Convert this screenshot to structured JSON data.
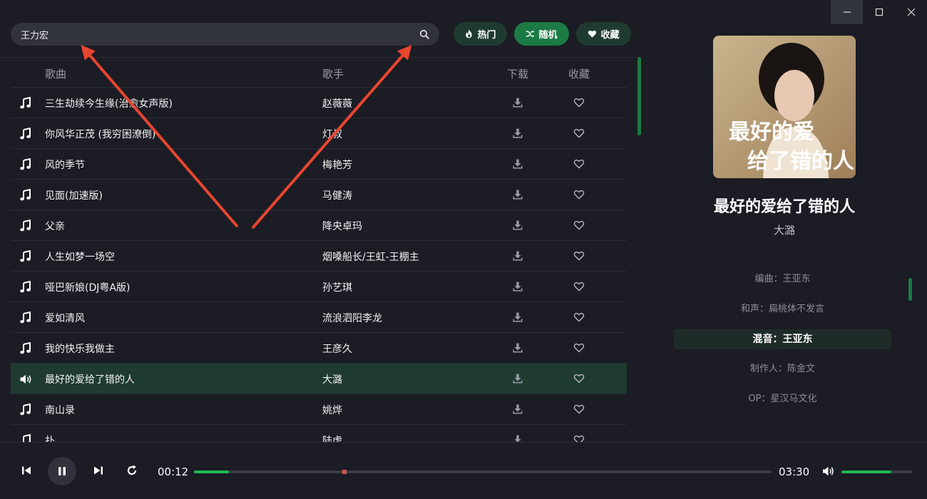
{
  "window": {
    "controls": [
      "minimize-icon",
      "maximize-icon",
      "close-icon"
    ]
  },
  "search": {
    "value": "王力宏",
    "icon": "search-icon"
  },
  "filters": {
    "hot": {
      "label": "热门",
      "icon": "fire-icon"
    },
    "random": {
      "label": "随机",
      "icon": "shuffle-icon"
    },
    "favorites": {
      "label": "收藏",
      "icon": "heart-icon"
    }
  },
  "table": {
    "headers": {
      "song": "歌曲",
      "artist": "歌手",
      "download": "下载",
      "favorite": "收藏"
    },
    "rows": [
      {
        "title": "三生劫续今生缘(治愈女声版)",
        "artist": "赵薇薇",
        "active": false
      },
      {
        "title": "你风华正茂 (我穷困潦倒)",
        "artist": "灯叔",
        "active": false
      },
      {
        "title": "风的季节",
        "artist": "梅艳芳",
        "active": false
      },
      {
        "title": "见面(加速版)",
        "artist": "马健涛",
        "active": false
      },
      {
        "title": "父亲",
        "artist": "降央卓玛",
        "active": false
      },
      {
        "title": "人生如梦一场空",
        "artist": "烟嗓船长/王虹-王棚主",
        "active": false
      },
      {
        "title": "哑巴新娘(DJ粤A版)",
        "artist": "孙艺琪",
        "active": false
      },
      {
        "title": "爱如清风",
        "artist": "流浪泗阳李龙",
        "active": false
      },
      {
        "title": "我的快乐我做主",
        "artist": "王彦久",
        "active": false
      },
      {
        "title": "最好的爱给了错的人",
        "artist": "大潞",
        "active": true
      },
      {
        "title": "南山录",
        "artist": "姚烨",
        "active": false
      },
      {
        "title": "扑",
        "artist": "陆虎",
        "active": false
      }
    ]
  },
  "now_playing": {
    "title": "最好的爱给了错的人",
    "artist": "大潞",
    "cover_text": {
      "line1": "最好的爱",
      "line2": "给了错的人"
    },
    "lyrics": [
      "编曲：王亚东",
      "和声：扁桃体不发言",
      "混音：王亚东",
      "制作人：陈金文",
      "OP：星汉马文化"
    ],
    "current_lyric_index": 2
  },
  "player": {
    "current_time": "00:12",
    "total_time": "03:30",
    "progress_fraction": 0.06,
    "volume_fraction": 0.7
  },
  "colors": {
    "accent": "#1db954",
    "active_row": "#1f3b31",
    "arrow": "#e8452f",
    "background": "#1b1c24"
  }
}
